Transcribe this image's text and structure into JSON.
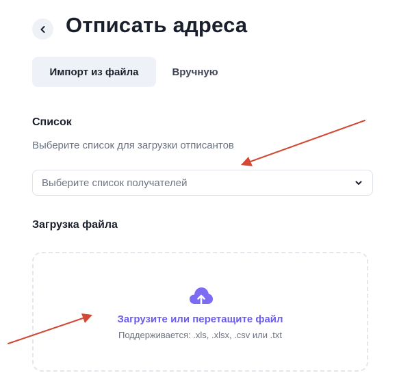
{
  "header": {
    "title": "Отписать адреса"
  },
  "tabs": [
    {
      "label": "Импорт из файла",
      "active": true
    },
    {
      "label": "Вручную",
      "active": false
    }
  ],
  "list_section": {
    "title": "Список",
    "description": "Выберите список для загрузки отписантов",
    "select_placeholder": "Выберите список получателей"
  },
  "upload_section": {
    "title": "Загрузка файла",
    "upload_link": "Загрузите или перетащите файл",
    "supported_formats": "Поддерживается: .xls, .xlsx, .csv или .txt"
  },
  "colors": {
    "accent": "#6b5cf0",
    "annotation_arrow": "#d24a36",
    "tab_active_bg": "#eef2f8"
  }
}
